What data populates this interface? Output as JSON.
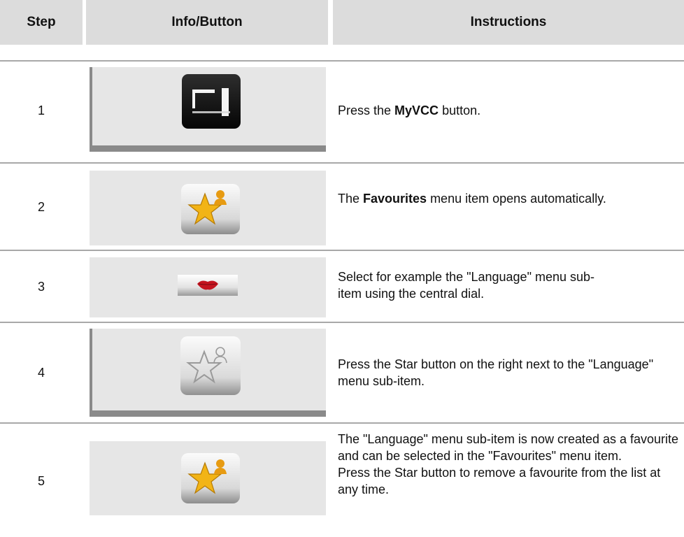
{
  "table": {
    "headers": {
      "step": "Step",
      "info": "Info/Button",
      "instructions": "Instructions"
    },
    "rows": [
      {
        "step": "1",
        "icon": "myvcc-button-icon",
        "instr": {
          "pre": "Press the ",
          "bold": "MyVCC",
          "post": " button."
        }
      },
      {
        "step": "2",
        "icon": "favourites-star-icon",
        "instr": {
          "pre": "The ",
          "bold": "Favourites",
          "post": " menu item opens automatically."
        }
      },
      {
        "step": "3",
        "icon": "language-lips-icon",
        "instr": {
          "line1": "Select for example the \"Language\" menu sub-",
          "line2": "item using the central dial."
        }
      },
      {
        "step": "4",
        "icon": "star-button-grey-icon",
        "instr": {
          "text": "Press the Star button on the right next to the \"Language\" menu sub-item."
        }
      },
      {
        "step": "5",
        "icon": "favourites-star-icon",
        "instr": {
          "p1": "The \"Language\" menu sub-item is now created as a favourite and can be selected in the \"Favourites\" menu item.",
          "p2": "Press the Star button to remove a favourite from the list at any time."
        }
      }
    ]
  },
  "colors": {
    "header_bg": "#dcdcdc",
    "panel_bg": "#e6e6e6",
    "rule": "#a8a8a8",
    "star_gold": "#f2b416"
  }
}
